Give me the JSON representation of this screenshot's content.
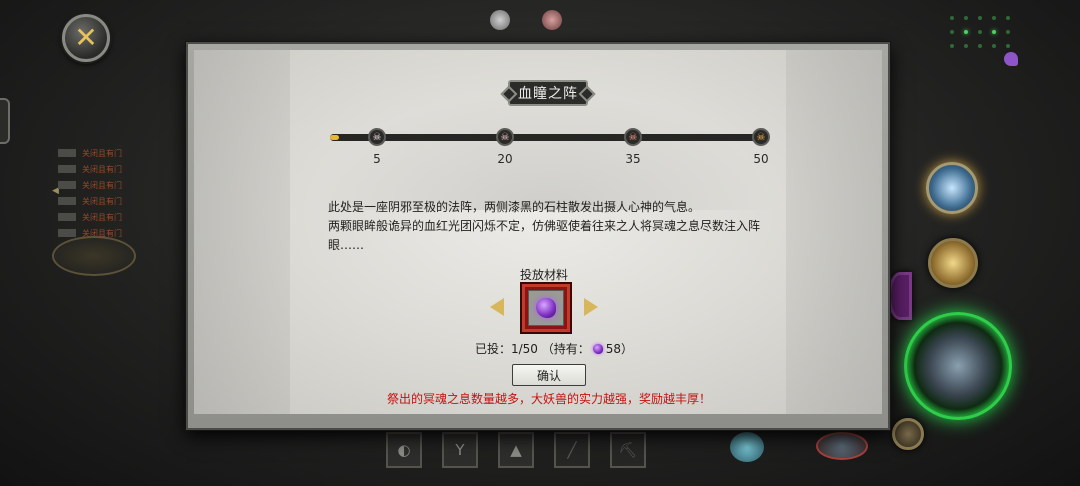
{
  "hud": {
    "close_glyph": "✕",
    "chat_lines": [
      "关闭且有门",
      "关闭且有门",
      "关闭且有门",
      "关闭且有门",
      "关闭且有门",
      "关闭且有门"
    ],
    "bottom_slots": [
      {
        "icon": "skill-leaf-icon",
        "glyph": "◐"
      },
      {
        "icon": "skill-wing-icon",
        "glyph": "Y"
      },
      {
        "icon": "skill-jar-icon",
        "glyph": "▲"
      },
      {
        "icon": "skill-needle-icon",
        "glyph": "╱"
      },
      {
        "icon": "skill-pick-icon",
        "glyph": "⛏"
      }
    ]
  },
  "dialog": {
    "title": "血瞳之阵",
    "progress": {
      "current": 1,
      "max": 50,
      "milestones": [
        {
          "value": "5",
          "glyph": "☠"
        },
        {
          "value": "20",
          "glyph": "☠"
        },
        {
          "value": "35",
          "glyph": "☠"
        },
        {
          "value": "50",
          "glyph": "☠"
        }
      ]
    },
    "description_line1": "此处是一座阴邪至极的法阵，两侧漆黑的石柱散发出摄人心神的气息。",
    "description_line2": "两颗眼眸般诡异的血红光团闪烁不定，仿佛驱使着往来之人将冥魂之息尽数注入阵眼……",
    "material_label": "投放材料",
    "invested_text": "已投：1/50 （持有：",
    "owned_count": "58）",
    "confirm_label": "确认",
    "hint": "祭出的冥魂之息数量越多，大妖兽的实力越强，奖励越丰厚！"
  },
  "colors": {
    "accent_gold": "#e8b82e",
    "hint_red": "#c5120e",
    "item_frame_red": "#8a1414",
    "soul_purple": "#7b2dbf"
  }
}
